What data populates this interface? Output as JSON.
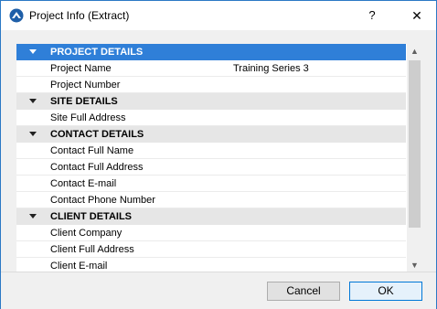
{
  "window": {
    "title": "Project Info (Extract)",
    "help_label": "?",
    "close_label": "✕"
  },
  "sections": [
    {
      "header": "PROJECT DETAILS",
      "selected": true,
      "rows": [
        {
          "label": "Project Name",
          "value": "Training Series 3"
        },
        {
          "label": "Project Number",
          "value": ""
        }
      ]
    },
    {
      "header": "SITE DETAILS",
      "selected": false,
      "rows": [
        {
          "label": "Site Full Address",
          "value": ""
        }
      ]
    },
    {
      "header": "CONTACT DETAILS",
      "selected": false,
      "rows": [
        {
          "label": "Contact Full Name",
          "value": ""
        },
        {
          "label": "Contact Full Address",
          "value": ""
        },
        {
          "label": "Contact E-mail",
          "value": ""
        },
        {
          "label": "Contact Phone Number",
          "value": ""
        }
      ]
    },
    {
      "header": "CLIENT DETAILS",
      "selected": false,
      "rows": [
        {
          "label": "Client Company",
          "value": ""
        },
        {
          "label": "Client Full Address",
          "value": ""
        },
        {
          "label": "Client E-mail",
          "value": ""
        }
      ]
    }
  ],
  "scrollbar": {
    "up_icon": "▲",
    "down_icon": "▼"
  },
  "buttons": {
    "cancel": "Cancel",
    "ok": "OK"
  },
  "colors": {
    "selection": "#2f7fd8",
    "header_bg": "#e6e6e6",
    "accent_border": "#0078d7"
  }
}
